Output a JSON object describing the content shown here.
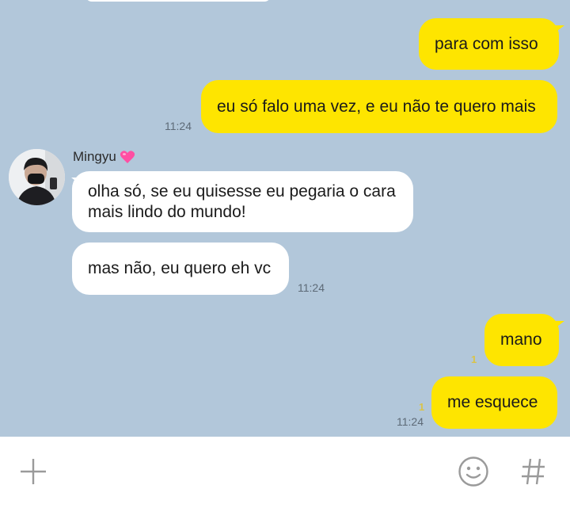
{
  "conversation": {
    "contact_name": "Mingyu",
    "messages": [
      {
        "id": "m1",
        "from": "me",
        "text": "para com isso"
      },
      {
        "id": "m2",
        "from": "me",
        "text": "eu só falo uma vez, e eu não te quero mais",
        "time": "11:24"
      },
      {
        "id": "m3",
        "from": "them",
        "text": "olha só, se eu quisesse eu pegaria o cara mais lindo do mundo!"
      },
      {
        "id": "m4",
        "from": "them",
        "text": "mas não, eu quero eh vc",
        "time": "11:24"
      },
      {
        "id": "m5",
        "from": "me",
        "text": "mano",
        "unread": "1"
      },
      {
        "id": "m6",
        "from": "me",
        "text": "me esquece",
        "unread": "1",
        "time": "11:24"
      }
    ]
  },
  "input_bar": {
    "icons": [
      "plus-icon",
      "emoji-icon",
      "hashtag-icon"
    ]
  },
  "colors": {
    "chat_background": "#b2c7da",
    "my_bubble": "#fee500",
    "their_bubble": "#ffffff",
    "heart": "#ff4fa3"
  }
}
